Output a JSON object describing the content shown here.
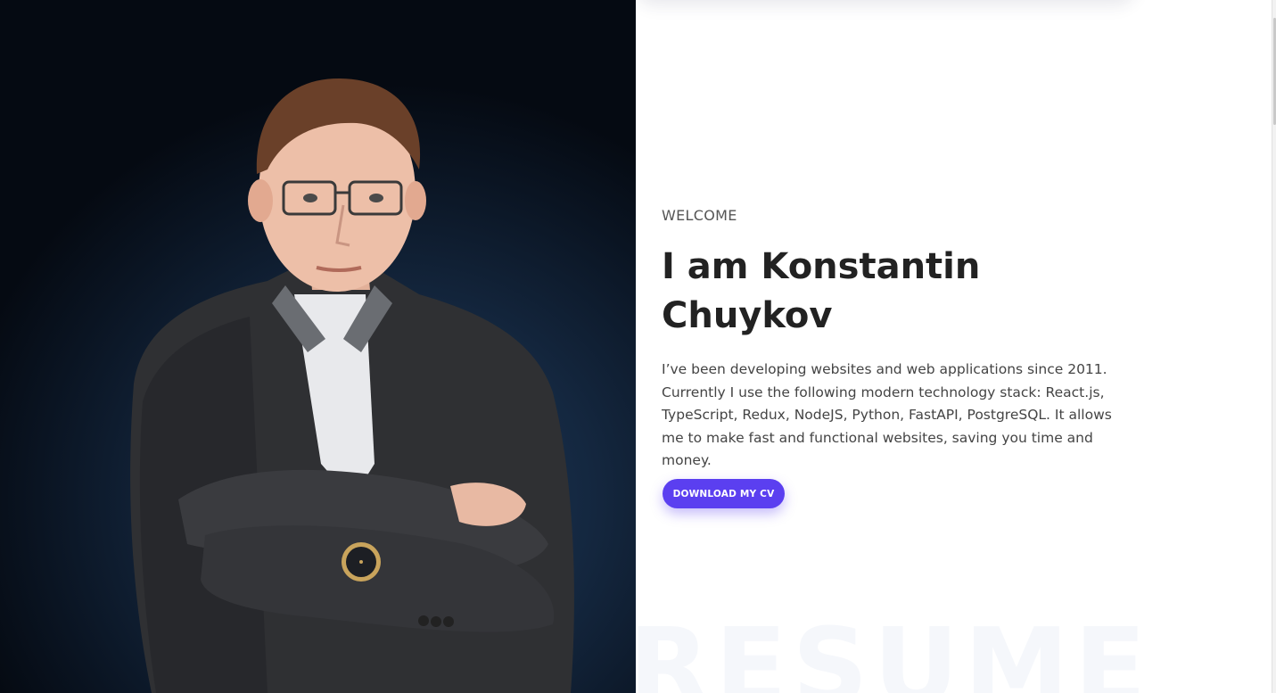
{
  "hero": {
    "welcome_label": "WELCOME",
    "headline_line1": "I am Konstantin",
    "headline_line2": "Chuykov",
    "description": "I’ve been developing websites and web applications since 2011. Currently I use the following modern technology stack: React.js, TypeScript, Redux, NodeJS, Python, FastAPI, PostgreSQL. It allows me to make fast and functional websites, saving you time and money.",
    "cv_button_label": "DOWNLOAD MY CV",
    "watermark_text": "RESUME"
  },
  "colors": {
    "accent": "#5b3ff0",
    "heading": "#222222",
    "photo_background": "#14273f"
  }
}
